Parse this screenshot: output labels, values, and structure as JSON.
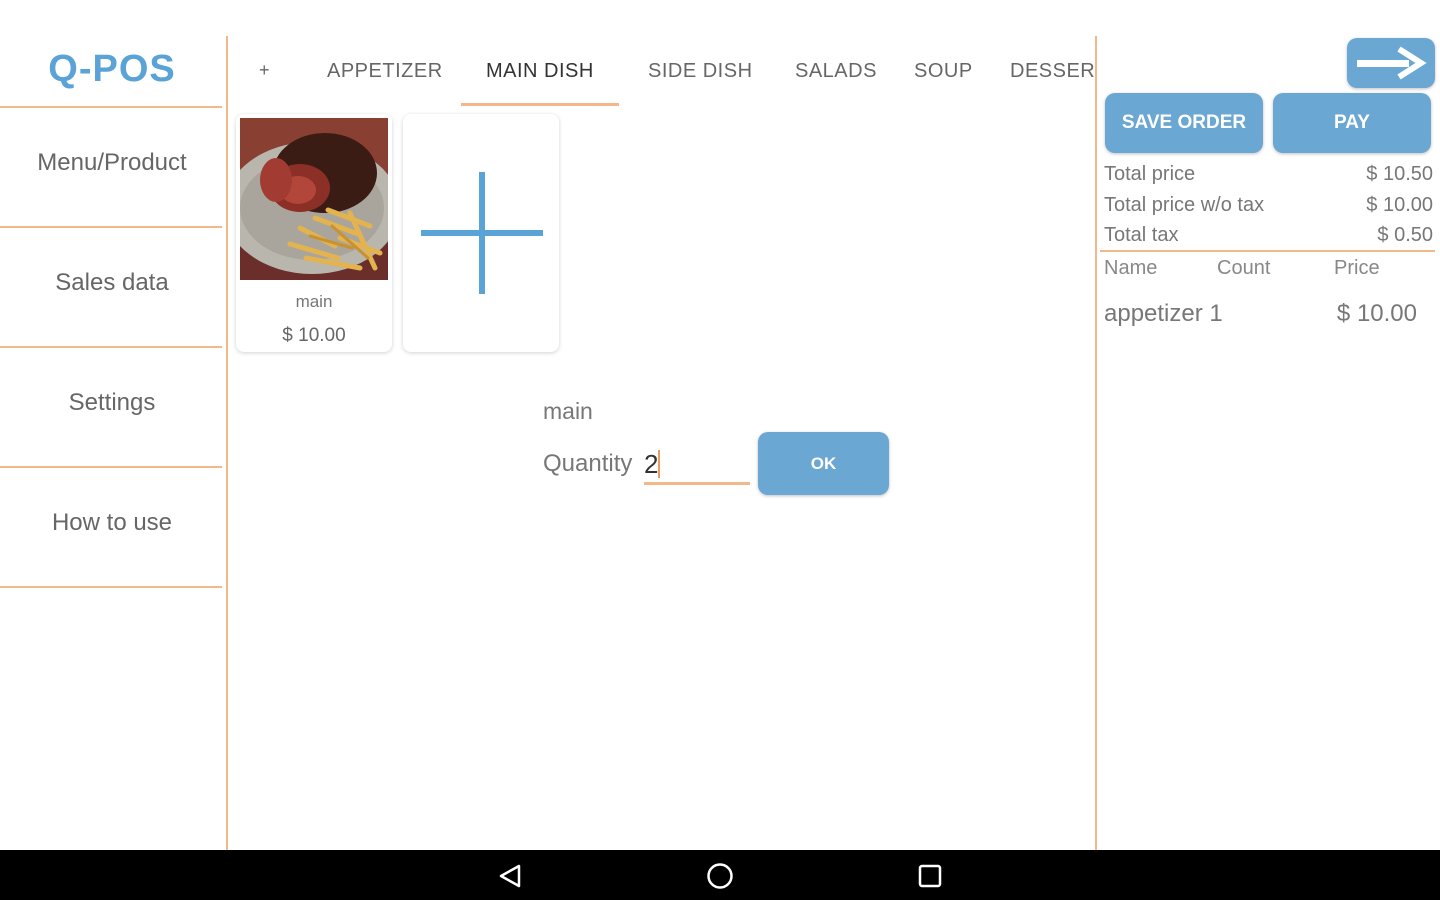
{
  "app": {
    "title": "Q-POS"
  },
  "sidebar": {
    "items": [
      {
        "label": "Menu/Product"
      },
      {
        "label": "Sales data"
      },
      {
        "label": "Settings"
      },
      {
        "label": "How to use"
      }
    ]
  },
  "tabs": {
    "add_label": "+",
    "items": [
      {
        "label": "APPETIZER"
      },
      {
        "label": "MAIN DISH",
        "active": true
      },
      {
        "label": "SIDE DISH"
      },
      {
        "label": "SALADS"
      },
      {
        "label": "SOUP"
      },
      {
        "label": "DESSERT"
      }
    ]
  },
  "products": [
    {
      "name": "main",
      "price": "$ 10.00",
      "image": "steak-with-fries-photo"
    }
  ],
  "add_product": {
    "icon": "plus-icon"
  },
  "dialog": {
    "product_name": "main",
    "quantity_label": "Quantity",
    "quantity_value": "2",
    "ok_label": "OK"
  },
  "order": {
    "next_icon": "arrow-right-icon",
    "save_label": "SAVE ORDER",
    "pay_label": "PAY",
    "summary": [
      {
        "label": "Total price",
        "value": "$ 10.50"
      },
      {
        "label": "Total price w/o tax",
        "value": "$ 10.00"
      },
      {
        "label": "Total tax",
        "value": "$ 0.50"
      }
    ],
    "columns": {
      "name": "Name",
      "count": "Count",
      "price": "Price"
    },
    "lines": [
      {
        "name": "appetizer 1",
        "count": "",
        "price": "$ 10.00"
      }
    ]
  },
  "colors": {
    "accent_blue": "#6ba7d3",
    "logo_blue": "#5aa3d6",
    "divider_orange": "#f3b78a"
  },
  "navbar": {
    "back": "back-icon",
    "home": "home-icon",
    "recents": "recents-icon"
  }
}
